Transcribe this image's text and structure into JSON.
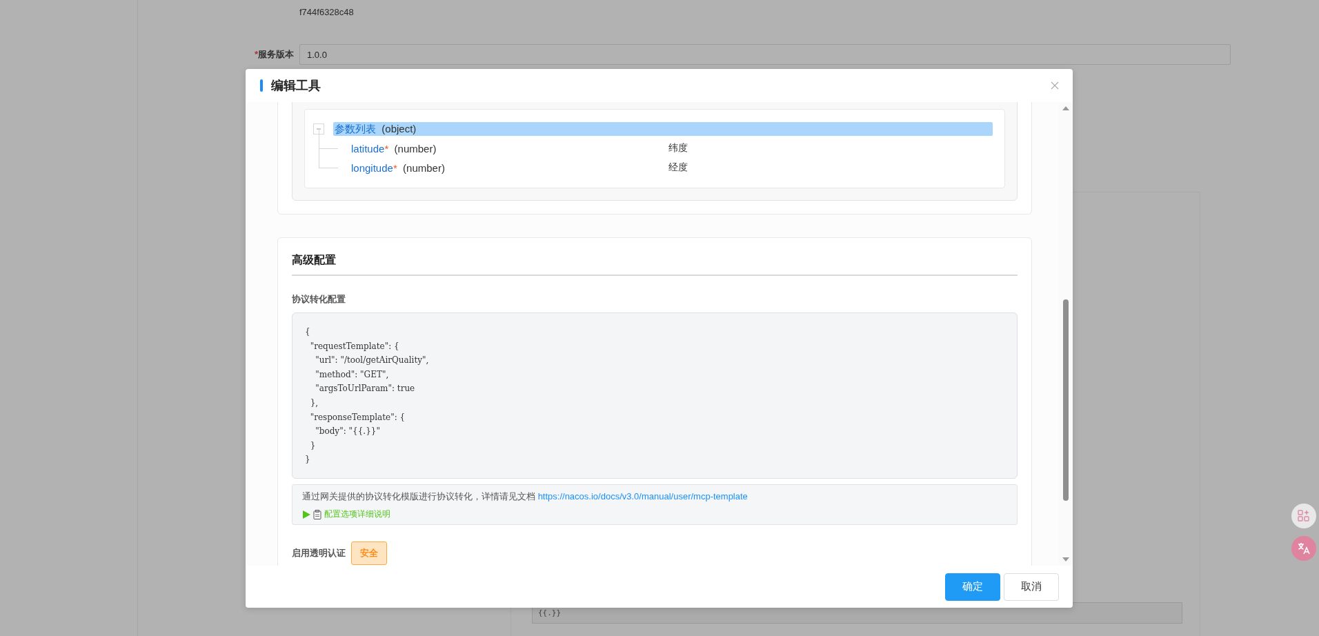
{
  "background": {
    "hash_text": "f744f6328c48",
    "version_field": {
      "required_mark": "*",
      "label": "服务版本",
      "value": "1.0.0"
    },
    "template_preview": "{{.}}"
  },
  "dialog": {
    "title": "编辑工具",
    "tree": {
      "label": "参数列表",
      "type": "(object)",
      "selected": true,
      "expanded": true,
      "children": [
        {
          "name": "latitude",
          "required_mark": "*",
          "type": "(number)",
          "description": "纬度"
        },
        {
          "name": "longitude",
          "required_mark": "*",
          "type": "(number)",
          "description": "经度"
        }
      ]
    },
    "advanced": {
      "title": "高级配置",
      "protocol_label": "协议转化配置",
      "code": "{\n  \"requestTemplate\": {\n    \"url\": \"/tool/getAirQuality\",\n    \"method\": \"GET\",\n    \"argsToUrlParam\": true\n  },\n  \"responseTemplate\": {\n    \"body\": \"{{.}}\"\n  }\n}",
      "help_text": "通过网关提供的协议转化模版进行协议转化，详情请见文档",
      "help_link": "https://nacos.io/docs/v3.0/manual/user/mcp-template",
      "details_toggle": "配置选项详细说明",
      "details_expanded": false,
      "auth_label": "启用透明认证",
      "auth_tag": "安全"
    },
    "buttons": [
      {
        "label": "确定",
        "kind": "primary"
      },
      {
        "label": "取消",
        "kind": "default"
      }
    ]
  }
}
